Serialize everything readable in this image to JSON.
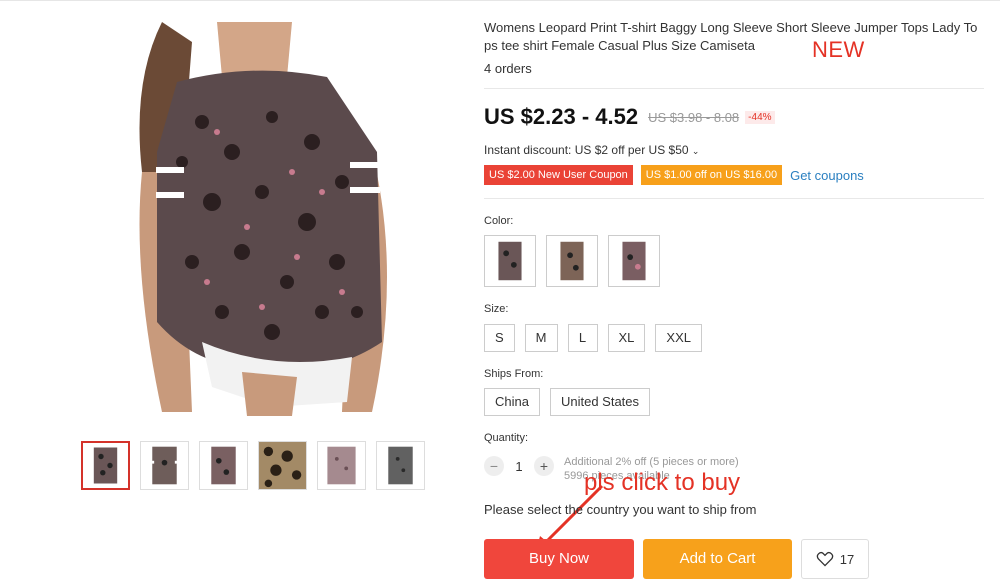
{
  "product": {
    "title": "Womens Leopard Print T-shirt Baggy Long Sleeve Short Sleeve Jumper Tops Lady To ps tee shirt Female Casual Plus Size Camiseta",
    "new_badge": "NEW",
    "orders": "4 orders"
  },
  "pricing": {
    "price": "US $2.23 - 4.52",
    "original_price": "US $3.98 - 8.08",
    "discount": "-44%",
    "instant_discount": "Instant discount: US $2 off per US $50",
    "coupons": [
      {
        "label": "US $2.00 New User Coupon",
        "color": "#ea4336"
      },
      {
        "label": "US $1.00 off on US $16.00",
        "color": "#f7a01a"
      }
    ],
    "get_coupons": "Get coupons"
  },
  "options": {
    "color_label": "Color:",
    "size_label": "Size:",
    "sizes": [
      "S",
      "M",
      "L",
      "XL",
      "XXL"
    ],
    "ships_from_label": "Ships From:",
    "ships_from": [
      "China",
      "United States"
    ]
  },
  "quantity": {
    "label": "Quantity:",
    "minus": "−",
    "value": "1",
    "plus": "+",
    "bulk_discount": "Additional 2% off (5 pieces or more)",
    "available": "5996 pieces available"
  },
  "annotation": {
    "text": "pls click to buy"
  },
  "ship_note": "Please select the country you want to ship from",
  "actions": {
    "buy_now": "Buy Now",
    "add_to_cart": "Add to Cart",
    "wishlist_count": "17"
  },
  "colors": {
    "accent_red": "#f0463c",
    "accent_orange": "#f7a11b",
    "link_blue": "#2a7fc0"
  }
}
